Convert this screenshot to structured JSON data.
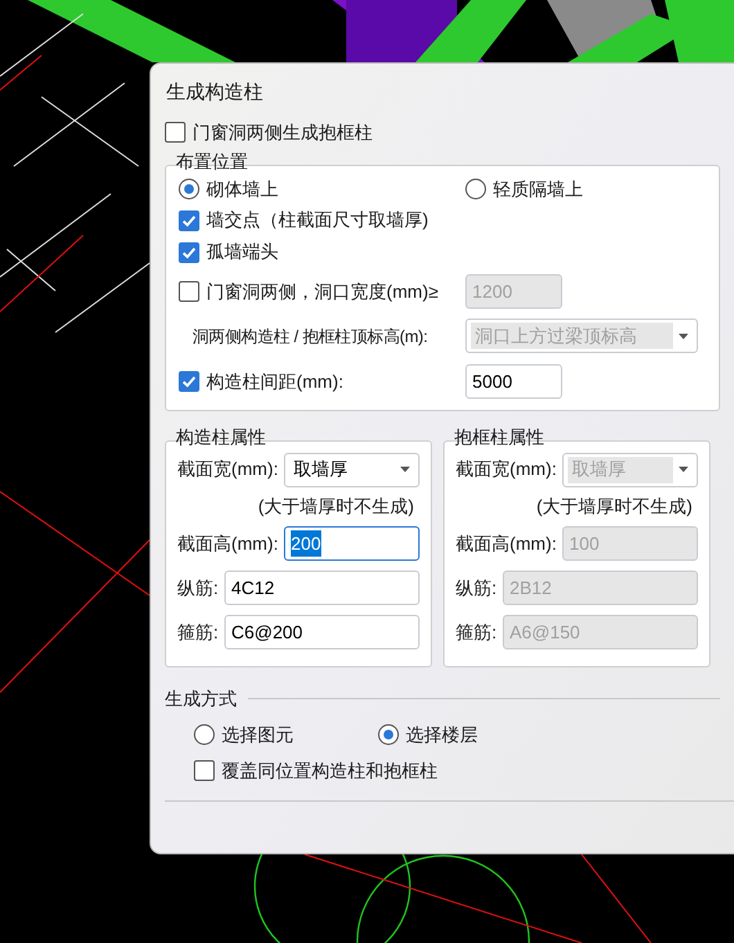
{
  "dialog": {
    "title": "生成构造柱"
  },
  "frame_column_option": {
    "label": "门窗洞两侧生成抱框柱",
    "checked": false
  },
  "placement": {
    "title": "布置位置",
    "wall_types": [
      {
        "label": "砌体墙上",
        "selected": true
      },
      {
        "label": "轻质隔墙上",
        "selected": false
      }
    ],
    "options": [
      {
        "kind": "check",
        "label": "墙交点（柱截面尺寸取墙厚)",
        "checked": true
      },
      {
        "kind": "check",
        "label": "孤墙端头",
        "checked": true
      },
      {
        "kind": "check_field",
        "label": "门窗洞两侧，洞口宽度(mm)≥",
        "checked": false,
        "value": "1200",
        "disabled": true
      },
      {
        "kind": "select",
        "label": "洞两侧构造柱 / 抱框柱顶标高(m):",
        "value": "洞口上方过梁顶标高",
        "disabled": true
      },
      {
        "kind": "check_field",
        "label": "构造柱间距(mm):",
        "checked": true,
        "value": "5000",
        "disabled": false
      }
    ]
  },
  "properties": [
    {
      "title": "构造柱属性",
      "disabled": false,
      "width_label": "截面宽(mm):",
      "width_value": "取墙厚",
      "note": "(大于墙厚时不生成)",
      "height_label": "截面高(mm):",
      "height_value": "200",
      "text_selected": true,
      "rebar_label": "纵筋:",
      "rebar_value": "4C12",
      "stirrup_label": "箍筋:",
      "stirrup_value": "C6@200"
    },
    {
      "title": "抱框柱属性",
      "disabled": true,
      "width_label": "截面宽(mm):",
      "width_value": "取墙厚",
      "note": "(大于墙厚时不生成)",
      "height_label": "截面高(mm):",
      "height_value": "100",
      "text_selected": false,
      "rebar_label": "纵筋:",
      "rebar_value": "2B12",
      "stirrup_label": "箍筋:",
      "stirrup_value": "A6@150"
    }
  ],
  "generation": {
    "title": "生成方式",
    "modes": [
      {
        "label": "选择图元",
        "selected": false
      },
      {
        "label": "选择楼层",
        "selected": true
      }
    ],
    "overwrite": {
      "label": "覆盖同位置构造柱和抱框柱",
      "checked": false
    }
  }
}
